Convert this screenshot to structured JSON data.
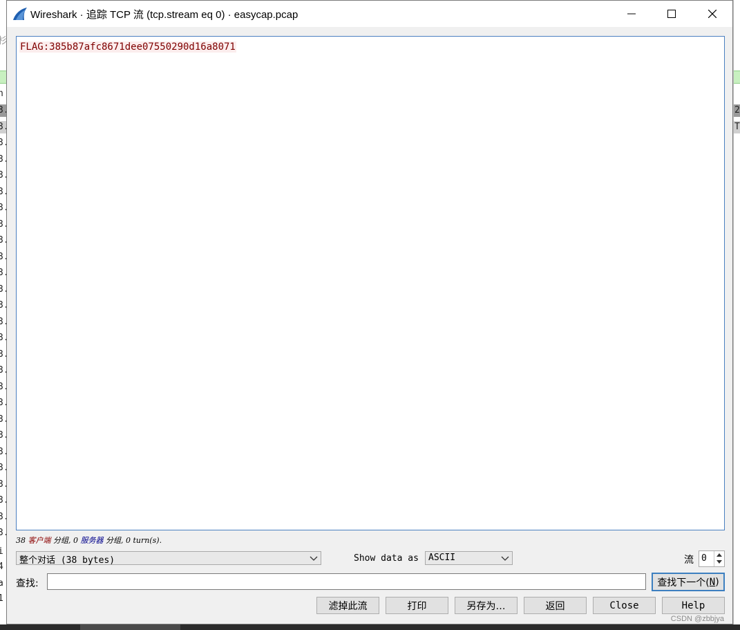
{
  "background": {
    "left_glyphs": [
      "杉",
      "n",
      "3.",
      "3.",
      "3.",
      "3.",
      "3.",
      "3.",
      "3.",
      "3.",
      "3.",
      "3.",
      "3.",
      "3.",
      "3.",
      "3.",
      "3.",
      "3.",
      "3.",
      "3.",
      "3.",
      "3.",
      "3.",
      "3.",
      "3.",
      "3.",
      "3.",
      "3.",
      "3.",
      "i",
      "4",
      "a",
      "1"
    ],
    "right_glyphs": [
      "2",
      "T"
    ]
  },
  "window": {
    "title": "Wireshark · 追踪 TCP 流 (tcp.stream eq 0) · easycap.pcap",
    "minimize_glyph": "─",
    "maximize_glyph": "☐",
    "close_glyph": "✕"
  },
  "stream": {
    "content": "FLAG:385b87afc8671dee07550290d16a8071"
  },
  "stats": {
    "client_count": "38",
    "client_label": "客户端",
    "client_suffix": "分组,",
    "server_count": "0",
    "server_label": "服务器",
    "server_suffix": "分组,",
    "turns": "0 turn(s)."
  },
  "controls": {
    "conversation_select": "整个对话 (38 bytes)",
    "show_data_label": "Show data as",
    "show_data_value": "ASCII",
    "stream_label": "流",
    "stream_value": "0",
    "find_label": "查找:",
    "find_value": "",
    "find_next_label": "查找下一个(",
    "find_next_key": "N",
    "find_next_close": ")"
  },
  "buttons": {
    "filter_out": "滤掉此流",
    "print": "打印",
    "save_as": "另存为…",
    "back": "返回",
    "close": "Close",
    "help": "Help"
  },
  "watermark": "CSDN @zbbjya",
  "colors": {
    "client_text": "#7f0000",
    "client_bg": "#fbeded",
    "server_text": "#00008b",
    "focus_border": "#3c7fc0"
  }
}
